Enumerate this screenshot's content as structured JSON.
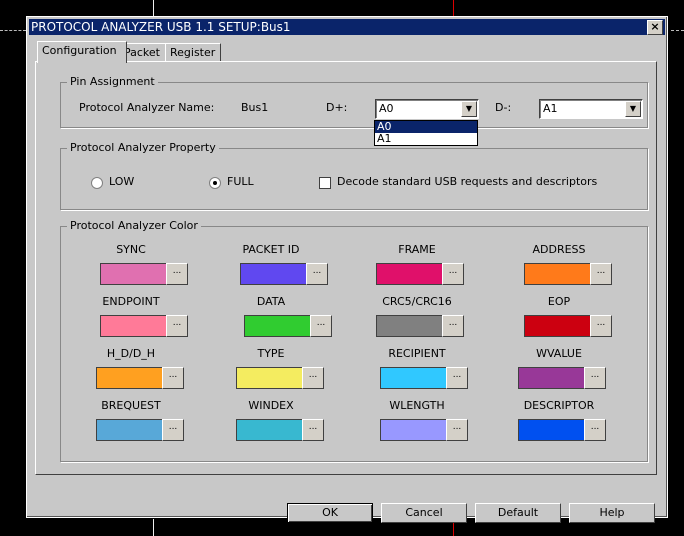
{
  "window": {
    "title": "PROTOCOL ANALYZER USB 1.1 SETUP:Bus1",
    "close_label": "×"
  },
  "tabs": [
    {
      "label": "Configuration"
    },
    {
      "label": "Packet"
    },
    {
      "label": "Register"
    }
  ],
  "pin_assignment": {
    "title": "Pin Assignment",
    "name_label": "Protocol Analyzer Name:",
    "name_value": "Bus1",
    "dplus_label": "D+:",
    "dplus_value": "A0",
    "dplus_options": [
      "A0",
      "A1"
    ],
    "dminus_label": "D-:",
    "dminus_value": "A1"
  },
  "property": {
    "title": "Protocol Analyzer Property",
    "low_label": "LOW",
    "full_label": "FULL",
    "selected_speed": "FULL",
    "decode_label": "Decode standard USB requests and descriptors",
    "decode_checked": false
  },
  "color": {
    "title": "Protocol Analyzer Color",
    "button_label": "...",
    "items": [
      {
        "label": "SYNC",
        "color": "#e070b0"
      },
      {
        "label": "PACKET ID",
        "color": "#6048f0"
      },
      {
        "label": "FRAME",
        "color": "#e0106a"
      },
      {
        "label": "ADDRESS",
        "color": "#ff7a1a"
      },
      {
        "label": "ENDPOINT",
        "color": "#ff7a98"
      },
      {
        "label": "DATA",
        "color": "#30cc30"
      },
      {
        "label": "CRC5/CRC16",
        "color": "#808080"
      },
      {
        "label": "EOP",
        "color": "#cc0010"
      },
      {
        "label": "H_D/D_H",
        "color": "#ffa020"
      },
      {
        "label": "TYPE",
        "color": "#f4ec60"
      },
      {
        "label": "RECIPIENT",
        "color": "#30c8ff"
      },
      {
        "label": "WVALUE",
        "color": "#983898"
      },
      {
        "label": "BREQUEST",
        "color": "#58a8d8"
      },
      {
        "label": "WINDEX",
        "color": "#38b8d0"
      },
      {
        "label": "WLENGTH",
        "color": "#9898ff"
      },
      {
        "label": "DESCRIPTOR",
        "color": "#0050f0"
      }
    ]
  },
  "buttons": {
    "ok": "OK",
    "cancel": "Cancel",
    "default": "Default",
    "help": "Help"
  }
}
